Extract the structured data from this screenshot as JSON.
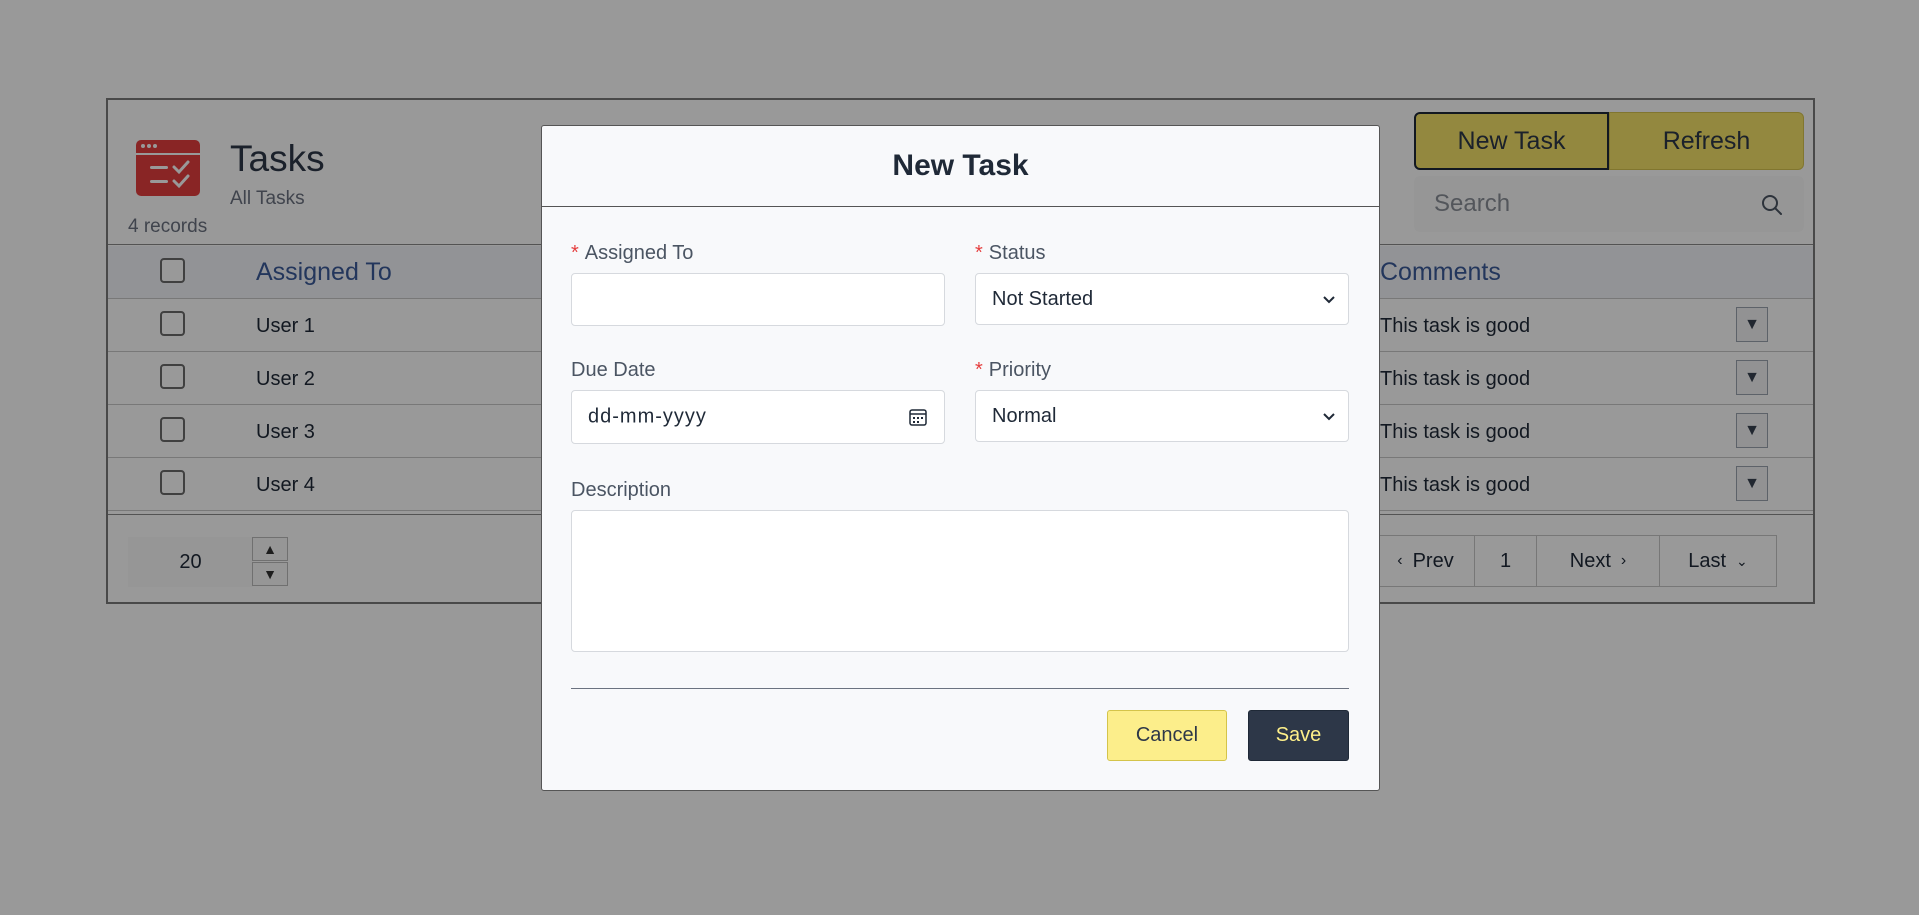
{
  "page": {
    "title": "Tasks",
    "subtitle": "All Tasks",
    "record_count": "4 records",
    "buttons": {
      "new_task": "New Task",
      "refresh": "Refresh"
    },
    "search": {
      "placeholder": "Search"
    },
    "icons": {
      "app": "task-list-icon",
      "search": "search-icon",
      "row_menu": "caret-down-icon"
    },
    "colors": {
      "accent": "#f6e36a",
      "app_icon": "#e53e3e",
      "header_text": "#3b5b9a"
    }
  },
  "table": {
    "columns": [
      "Assigned To",
      "Comments"
    ],
    "rows": [
      {
        "assigned_to": "User 1",
        "comments": "This task is good"
      },
      {
        "assigned_to": "User 2",
        "comments": "This task is good"
      },
      {
        "assigned_to": "User 3",
        "comments": "This task is good"
      },
      {
        "assigned_to": "User 4",
        "comments": "This task is good"
      }
    ]
  },
  "pagination": {
    "page_size": "20",
    "prev": "Prev",
    "current": "1",
    "next": "Next",
    "last": "Last"
  },
  "modal": {
    "title": "New Task",
    "fields": {
      "assigned_to": {
        "label": "Assigned To",
        "required": true,
        "value": ""
      },
      "status": {
        "label": "Status",
        "required": true,
        "value": "Not Started"
      },
      "due_date": {
        "label": "Due Date",
        "required": false,
        "placeholder": "dd-mm-yyyy"
      },
      "priority": {
        "label": "Priority",
        "required": true,
        "value": "Normal"
      },
      "description": {
        "label": "Description",
        "value": ""
      }
    },
    "buttons": {
      "cancel": "Cancel",
      "save": "Save"
    },
    "required_marker": "*",
    "colors": {
      "save_bg": "#2d3748",
      "save_text": "#fef08a",
      "cancel_bg": "#fcee8b",
      "required": "#e53e3e"
    }
  }
}
